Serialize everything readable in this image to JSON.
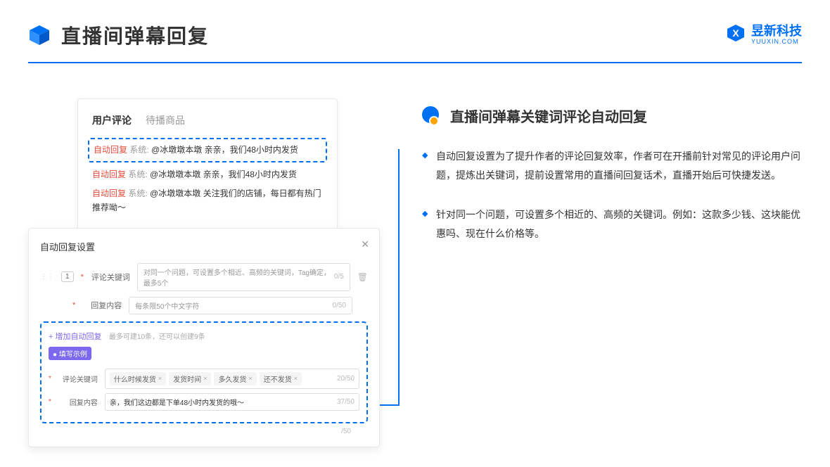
{
  "header": {
    "title": "直播间弹幕回复",
    "brand_name": "昱新科技",
    "brand_sub": "YUUXIN.COM"
  },
  "comments_card": {
    "tab_active": "用户评论",
    "tab_inactive": "待播商品",
    "auto_badge": "自动回复",
    "sys_label": "系统:",
    "c1": "@冰墩墩本墩 亲亲，我们48小时内发货",
    "c2": "@冰墩墩本墩 亲亲，我们48小时内发货",
    "c3": "@冰墩墩本墩 关注我们的店铺，每日都有热门推荐呦～"
  },
  "settings": {
    "title": "自动回复设置",
    "num": "1",
    "kw_label": "评论关键词",
    "kw_placeholder": "对同一个问题，可设置多个相近、高频的关键词，Tag确定，最多5个",
    "kw_counter": "0/5",
    "content_label": "回复内容",
    "content_placeholder": "每条限50个中文字符",
    "content_counter": "0/50",
    "add_link": "+ 增加自动回复",
    "add_hint": "最多可建10条，还可以创建9条",
    "ex_badge": "● 填写示例",
    "ex_kw_label": "评论关键词",
    "tags": [
      "什么时候发货",
      "发货时间",
      "多久发货",
      "还不发货"
    ],
    "ex_kw_counter": "20/50",
    "ex_content_label": "回复内容",
    "ex_content_text": "亲，我们这边都是下单48小时内发货的哦～",
    "ex_content_counter": "37/50",
    "outer_counter": "/50"
  },
  "right": {
    "section_title": "直播间弹幕关键词评论自动回复",
    "b1": "自动回复设置为了提升作者的评论回复效率，作者可在开播前针对常见的评论用户问题，提炼出关键词，提前设置常用的直播间回复话术，直播开始后可快捷发送。",
    "b2": "针对同一个问题，可设置多个相近的、高频的关键词。例如：这款多少钱、这块能优惠吗、现在什么价格等。"
  }
}
